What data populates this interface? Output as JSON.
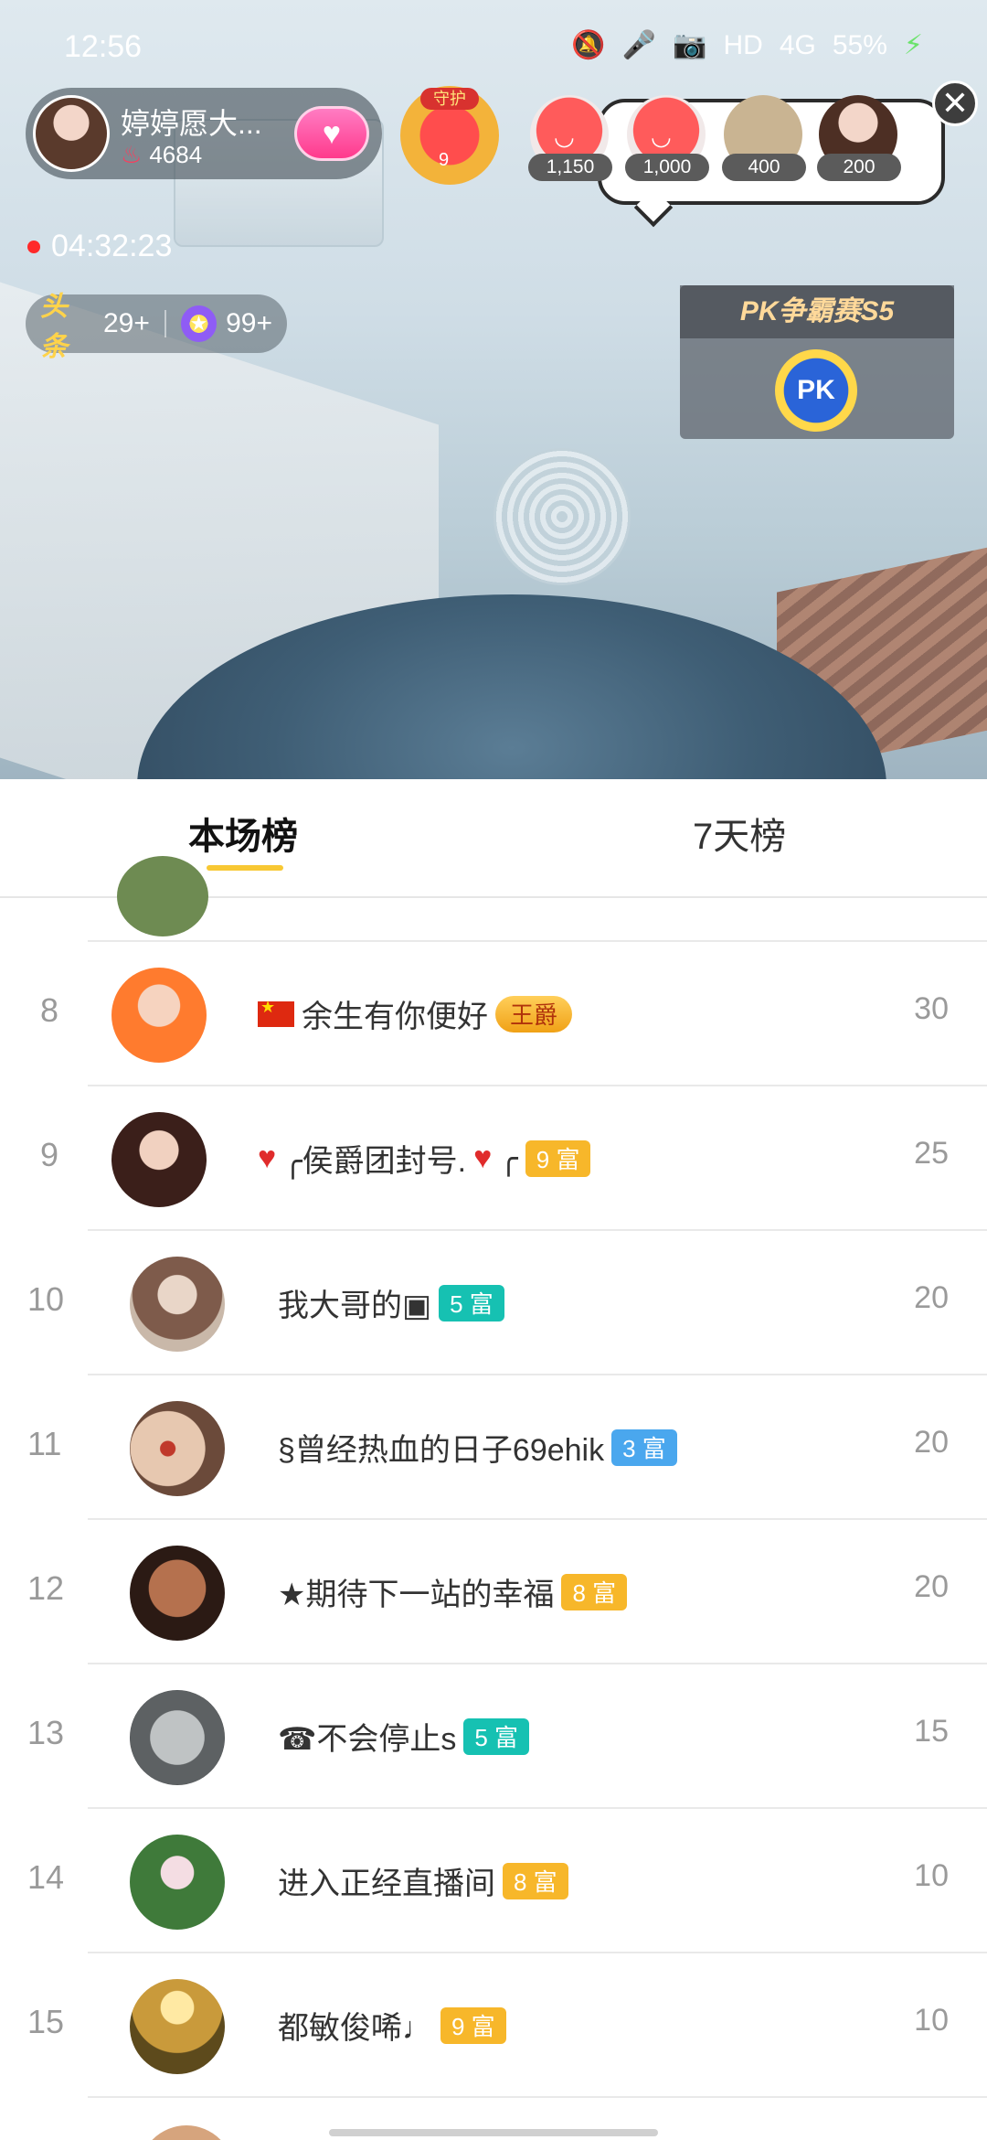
{
  "status_bar": {
    "time": "12:56",
    "network": "HD",
    "signal": "4G",
    "battery": "55%",
    "icons": [
      "mute-icon",
      "mic-icon",
      "camera-icon",
      "signal-icon",
      "charging-icon"
    ]
  },
  "host": {
    "name": "婷婷愿大...",
    "fans": "4684",
    "follow_icon": "heart-icon"
  },
  "guard": {
    "label": "守护",
    "level": "9"
  },
  "viewers": [
    {
      "score": "1,150"
    },
    {
      "score": "1,000"
    },
    {
      "score": "400"
    },
    {
      "score": "200"
    }
  ],
  "live_timer": "04:32:23",
  "rank_pill": {
    "toutiao_label": "头条",
    "toutiao_count": "29+",
    "star_count": "99+"
  },
  "pk": {
    "title": "PK争霸赛S5",
    "button": "PK"
  },
  "tabs": [
    {
      "label": "本场榜",
      "active": true
    },
    {
      "label": "7天榜",
      "active": false
    }
  ],
  "leaderboard": [
    {
      "rank": "8",
      "name": "余生有你便好",
      "badge": "王爵",
      "badge_type": "crown",
      "score": "30",
      "flag": true
    },
    {
      "rank": "9",
      "name": "╭侯爵团封号.",
      "badge": "9 富",
      "badge_type": "gold",
      "score": "25",
      "hearts": true
    },
    {
      "rank": "10",
      "name": "我大哥的▣",
      "badge": "5 富",
      "badge_type": "teal",
      "score": "20"
    },
    {
      "rank": "11",
      "name": "§曾经热血的日子69ehik",
      "badge": "3 富",
      "badge_type": "blue",
      "score": "20"
    },
    {
      "rank": "12",
      "name": "★期待下一站的幸福",
      "badge": "8 富",
      "badge_type": "gold",
      "score": "20"
    },
    {
      "rank": "13",
      "name": "☎不会停止s",
      "badge": "5 富",
      "badge_type": "teal",
      "score": "15"
    },
    {
      "rank": "14",
      "name": "进入正经直播间",
      "badge": "8 富",
      "badge_type": "gold",
      "score": "10"
    },
    {
      "rank": "15",
      "name": "都敏俊唏♩",
      "badge": "9 富",
      "badge_type": "gold",
      "score": "10"
    }
  ]
}
